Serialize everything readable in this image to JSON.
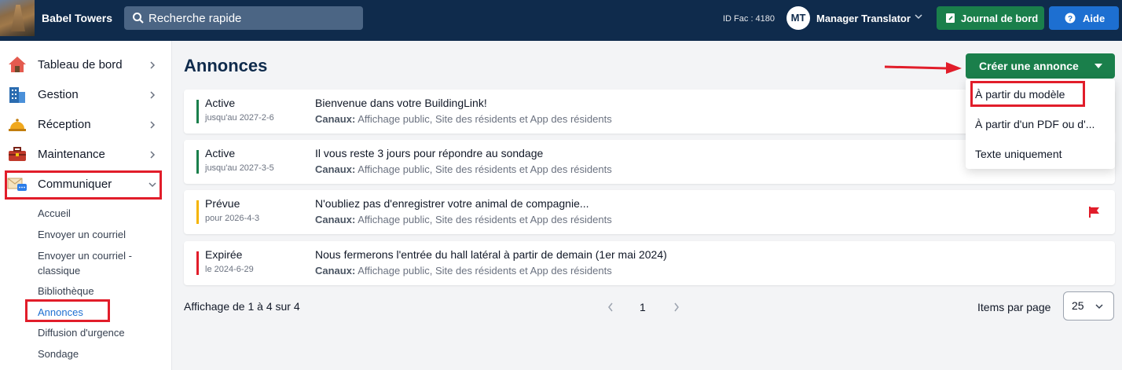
{
  "topbar": {
    "app_title": "Babel Towers",
    "search_placeholder": "Recherche rapide",
    "fac_id": "ID Fac : 4180",
    "avatar_initials": "MT",
    "user_name": "Manager Translator",
    "journal_label": "Journal de bord",
    "help_label": "Aide"
  },
  "sidebar": {
    "items": [
      {
        "label": "Tableau de bord",
        "icon": "house-icon"
      },
      {
        "label": "Gestion",
        "icon": "building-icon"
      },
      {
        "label": "Réception",
        "icon": "service-bell-icon"
      },
      {
        "label": "Maintenance",
        "icon": "toolbox-icon"
      },
      {
        "label": "Communiquer",
        "icon": "envelope-chat-icon"
      }
    ],
    "sub_items": [
      "Accueil",
      "Envoyer un courriel",
      "Envoyer un courriel -",
      "classique",
      "Bibliothèque",
      "Annonces",
      "Diffusion d'urgence",
      "Sondage"
    ]
  },
  "main": {
    "title": "Annonces",
    "create_button": "Créer une annonce",
    "channels_label": "Canaux:",
    "announcements": [
      {
        "status": "Active",
        "date": "jusqu'au 2027-2-6",
        "title": "Bienvenue dans votre BuildingLink!",
        "channels": "Affichage public, Site des résidents et App des résidents",
        "color": "#1a7f4b"
      },
      {
        "status": "Active",
        "date": "jusqu'au 2027-3-5",
        "title": "Il vous reste 3 jours pour répondre au sondage",
        "channels": "Affichage public, Site des résidents et App des résidents",
        "color": "#1a7f4b"
      },
      {
        "status": "Prévue",
        "date": "pour 2026-4-3",
        "title": "N'oubliez pas d'enregistrer votre animal de compagnie...",
        "channels": "Affichage public, Site des résidents et App des résidents",
        "color": "#f5b400"
      },
      {
        "status": "Expirée",
        "date": "le 2024-6-29",
        "title": "Nous fermerons l'entrée du hall latéral à partir de demain (1er mai 2024)",
        "channels": "Affichage public, Site des résidents et App des résidents",
        "color": "#e11d2a"
      }
    ],
    "dropdown": [
      "À partir du modèle",
      "À partir d'un PDF ou d'...",
      "Texte uniquement"
    ],
    "pagination": {
      "info": "Affichage de 1 à 4 sur 4",
      "current_page": "1",
      "items_per_page_label": "Items par page",
      "items_per_page_value": "25"
    }
  },
  "colors": {
    "topbar": "#0f2b4c",
    "primary_green": "#1a7f4b",
    "help_blue": "#1d6fd1",
    "highlight_red": "#e11d2a"
  }
}
